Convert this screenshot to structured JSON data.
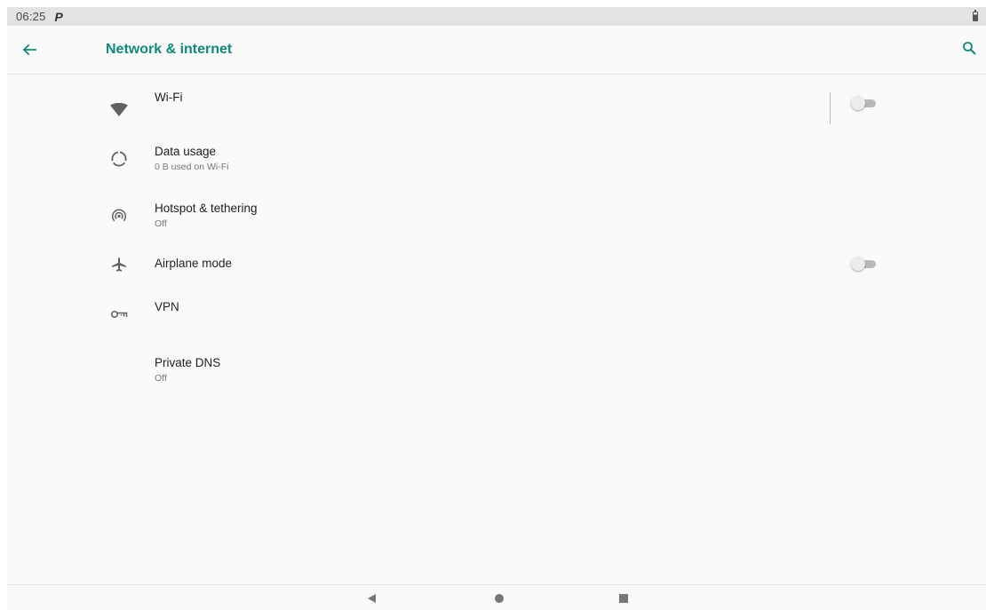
{
  "status_bar": {
    "time": "06:25",
    "notification_glyph": "P"
  },
  "toolbar": {
    "title": "Network & internet"
  },
  "items": [
    {
      "label": "Wi-Fi",
      "summary": "",
      "icon": "wifi-icon",
      "toggle": false
    },
    {
      "label": "Data usage",
      "summary": "0 B used on Wi-Fi",
      "icon": "data-usage-icon"
    },
    {
      "label": "Hotspot & tethering",
      "summary": "Off",
      "icon": "hotspot-icon"
    },
    {
      "label": "Airplane mode",
      "summary": "",
      "icon": "airplane-icon",
      "toggle": false
    },
    {
      "label": "VPN",
      "summary": "",
      "icon": "vpn-key-icon"
    },
    {
      "label": "Private DNS",
      "summary": "Off",
      "icon": ""
    }
  ],
  "colors": {
    "accent": "#0f8a7c",
    "icon": "#616161",
    "background": "#fafafa",
    "status_bar": "#e3e3e3"
  }
}
